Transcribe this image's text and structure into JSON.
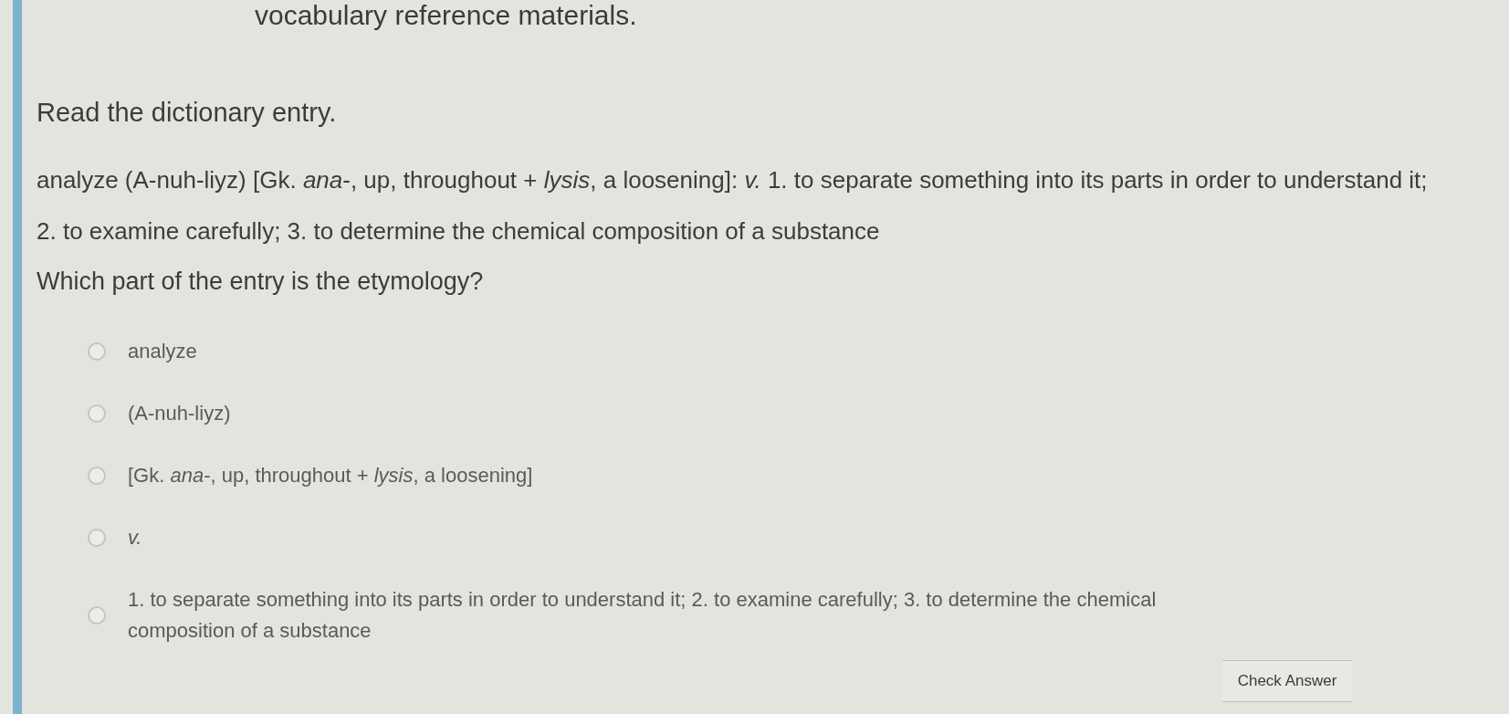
{
  "header": {
    "title": "vocabulary reference materials."
  },
  "instruction": "Read the dictionary entry.",
  "entry": "analyze (A-nuh-liyz) [Gk. *ana*-, up, throughout + *lysis*, a loosening]: *v.* 1. to separate something into its parts in order to understand it; 2. to examine carefully; 3. to determine the chemical composition of a substance",
  "question": "Which part of the entry is the etymology?",
  "options": [
    {
      "text": "analyze",
      "selected": false,
      "italic": false
    },
    {
      "text": "(A-nuh-liyz)",
      "selected": false,
      "italic": false
    },
    {
      "text": "[Gk. *ana*-, up, throughout + *lysis*, a loosening]",
      "selected": false,
      "italic": false
    },
    {
      "text": "v.",
      "selected": false,
      "italic": true
    },
    {
      "text": "1. to separate something into its parts in order to understand it; 2. to examine carefully; 3. to determine the chemical composition of a substance",
      "selected": false,
      "italic": false
    }
  ],
  "button": {
    "label": "Check Answer"
  }
}
